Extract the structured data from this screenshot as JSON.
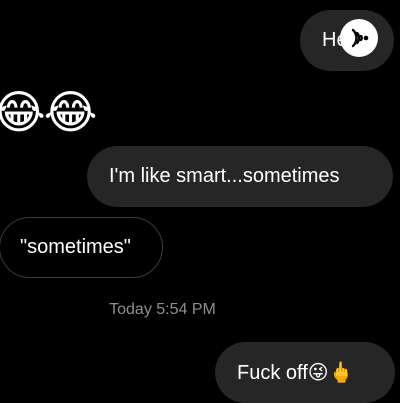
{
  "messages": [
    {
      "id": "msg1",
      "direction": "sent",
      "text": "Hey"
    },
    {
      "id": "msg2",
      "direction": "received",
      "text": "😂😂"
    },
    {
      "id": "msg3",
      "direction": "sent",
      "text": "I'm like smart...sometimes"
    },
    {
      "id": "msg4",
      "direction": "received",
      "text": "\"sometimes\""
    },
    {
      "id": "msg5",
      "direction": "sent",
      "text": "Fuck off😜🖕"
    }
  ],
  "timestamp": "Today 5:54 PM",
  "overlay": {
    "icon": "podcast-icon"
  },
  "colors": {
    "background": "#000000",
    "sent_bubble": "#262626",
    "received_border": "#3a3a3a",
    "text": "#ffffff",
    "timestamp": "#8e8e8e"
  }
}
